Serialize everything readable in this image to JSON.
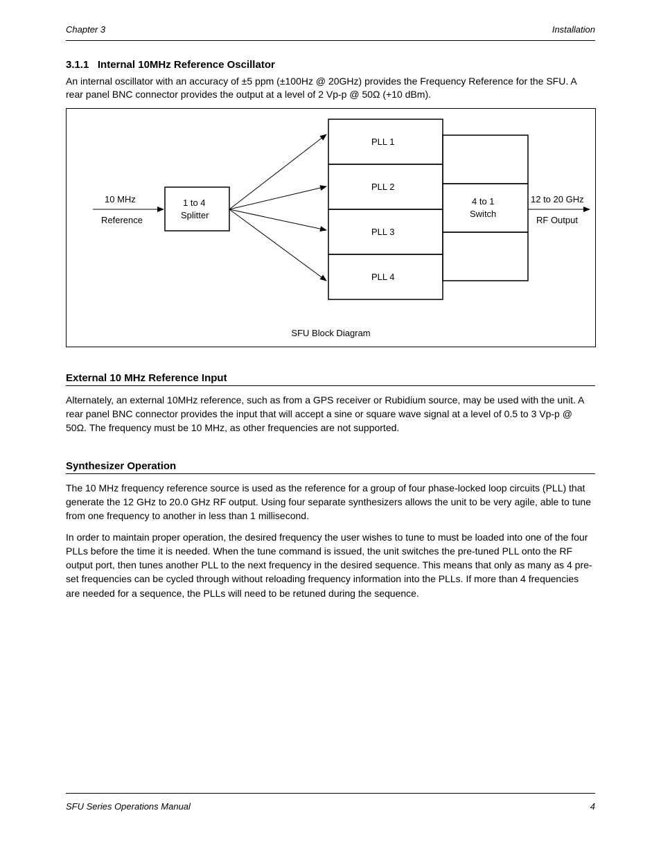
{
  "header": {
    "left": "Chapter 3",
    "right": "Installation"
  },
  "section1": {
    "number": "3.1.1",
    "title": "Internal 10MHz Reference Oscillator",
    "body": "An internal oscillator with an accuracy of ±5 ppm (±100Hz @ 20GHz) provides the Frequency Reference for the SFU.  A rear panel BNC connector provides the output at a level of 2 Vp-p @ 50Ω (+10 dBm)."
  },
  "diagram": {
    "input_arrow_label_top": "10 MHz",
    "input_arrow_label_bottom": "Reference",
    "box_left_top": "1 to 4",
    "box_left_bottom": "Splitter",
    "pll": [
      "PLL 1",
      "PLL 2",
      "PLL 3",
      "PLL 4"
    ],
    "box_right_top": "4 to 1",
    "box_right_bottom": "Switch",
    "output1": "12 to 20 GHz",
    "output2": "RF Output",
    "caption": "SFU Block Diagram"
  },
  "section2": {
    "title": "External 10 MHz Reference Input",
    "body_p1": "Alternately, an external 10MHz reference, such as from a GPS receiver or Rubidium source, may be used with the unit.  A rear panel BNC connector provides the input that will accept a sine or square wave signal at a level of 0.5 to 3 Vp-p @ 50Ω.  The frequency must be 10 MHz, as other frequencies are not supported."
  },
  "section3": {
    "title": "Synthesizer Operation",
    "body_p1": "The 10 MHz frequency reference source is used as the reference for a group of four phase-locked loop circuits (PLL) that generate the 12 GHz to 20.0 GHz RF output.  Using four separate synthesizers allows the unit to be very agile, able to tune from one frequency to another in less than 1 millisecond.",
    "body_p2": "In order to maintain proper operation, the desired frequency the user wishes to tune to must be loaded into one of the four PLLs before the time it is needed.  When the tune command is issued, the unit switches the pre-tuned PLL onto the RF output port, then tunes another PLL to the next frequency in the desired sequence.  This means that only as many as 4 pre-set frequencies can be cycled through without reloading frequency information into the PLLs.  If more than 4 frequencies are needed for a sequence, the PLLs will need to be retuned during the sequence."
  },
  "footer": {
    "left": "SFU Series Operations Manual",
    "right": "4"
  }
}
